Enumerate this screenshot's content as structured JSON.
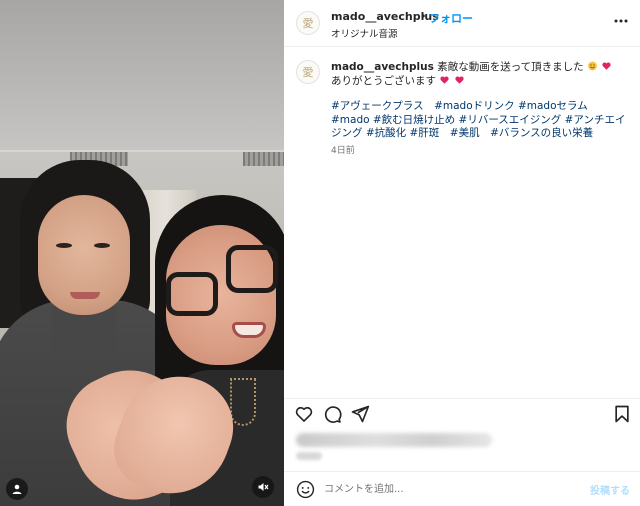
{
  "post": {
    "username": "mado__avechplus",
    "follow_label": "フォロー",
    "dot": "•",
    "audio": "オリジナル音源",
    "avatar_glyph": "愛"
  },
  "caption": {
    "username": "mado__avechplus",
    "text": "素敵な動画を送って頂きました",
    "line2": "ありがとうございます",
    "hashtags": "#アヴェークプラス　#madoドリンク #madoセラム #mado #飲む日焼け止め #リバースエイジング #アンチエイジング #抗酸化 #肝斑　#美肌　#バランスの良い栄養",
    "time": "4日前"
  },
  "comment": {
    "placeholder": "コメントを追加...",
    "post_label": "投稿する"
  },
  "icons": {
    "more": "more-options-icon",
    "like": "heart-icon",
    "comment": "comment-icon",
    "share": "send-icon",
    "save": "bookmark-icon",
    "emoji": "emoji-icon",
    "user_tag": "user-tag-icon",
    "mute": "muted-speaker-icon"
  },
  "colors": {
    "link": "#0095f6",
    "hashtag": "#00376b",
    "post_disabled": "#b2dffc",
    "heart_emoji": "#e0245e"
  }
}
